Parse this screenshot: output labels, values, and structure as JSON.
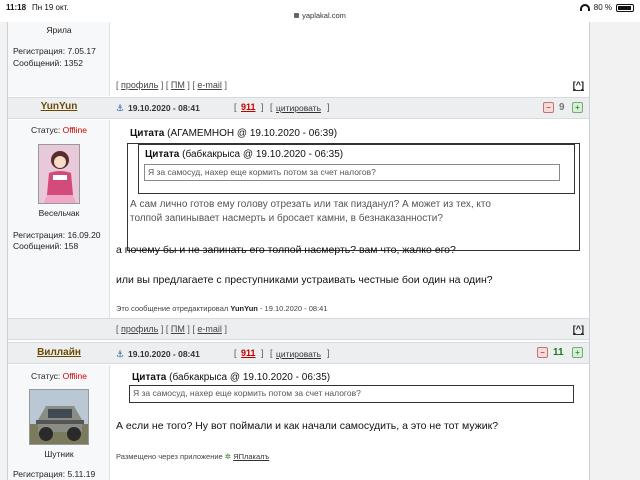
{
  "status_bar": {
    "time": "11:18",
    "date": "Пн 19 окт.",
    "url": "yaplakal.com",
    "battery": "80 %"
  },
  "post0": {
    "avatar_caption": "Ярила",
    "reg_label": "Регистрация:",
    "reg_value": "7.05.17",
    "msgs_label": "Сообщений:",
    "msgs_value": "1352"
  },
  "bar_links": {
    "profile": "профиль",
    "pm": "ПМ",
    "email": "e-mail",
    "top": "[^]",
    "open": "[",
    "close": "]"
  },
  "post1": {
    "author": "YunYun",
    "status_label": "Статус:",
    "status_value": "Offline",
    "avatar_caption": "Весельчак",
    "reg_label": "Регистрация:",
    "reg_value": "16.09.20",
    "msgs_label": "Сообщений:",
    "msgs_value": "158",
    "date": "19.10.2020 - 08:41",
    "post_number": "911",
    "cite_label": "цитировать",
    "score": "9",
    "quote_outer_prefix": "Цитата",
    "quote_outer_meta": "(АГАМЕМНОН @ 19.10.2020 - 06:39)",
    "quote_inner_prefix": "Цитата",
    "quote_inner_meta": "(бабкакрыса @ 19.10.2020 - 06:35)",
    "quote_inner_text": "Я за самосуд, нахер еще кормить потом за счет налогов?",
    "quote_outer_text_1": "А сам лично готов ему голову отрезать или так пизданул? А может из тех, кто",
    "quote_outer_text_2": "толпой запинывает насмерть и бросает камни, в безнаказанности?",
    "text_1": "а почему бы и не запинать его толпой насмерть? вам что, жалко его?",
    "text_2": "или вы предлагаете с преступниками устраивать честные бои один на один?",
    "edited_prefix": "Это сообщение отредактировал",
    "edited_user": "YunYun",
    "edited_suffix": "- 19.10.2020 - 08:41"
  },
  "post2": {
    "author": "Виллайн",
    "status_label": "Статус:",
    "status_value": "Offline",
    "avatar_caption": "Шутник",
    "reg_label": "Регистрация:",
    "reg_value": "5.11.19",
    "date": "19.10.2020 - 08:41",
    "post_number": "911",
    "cite_label": "цитировать",
    "score": "11",
    "quote_prefix": "Цитата",
    "quote_meta": "(бабкакрыса @ 19.10.2020 - 06:35)",
    "quote_text": "Я за самосуд, нахер еще кормить потом за счет налогов?",
    "text_1": "А если не того? Ну вот поймали и как начали самосудить, а это не тот мужик?",
    "via_prefix": "Размещено через приложение",
    "via_app": "ЯПлакалъ"
  },
  "colors": {
    "offline": "#d40000",
    "score_green": "#1a7a1a",
    "link_red": "#c00000"
  }
}
